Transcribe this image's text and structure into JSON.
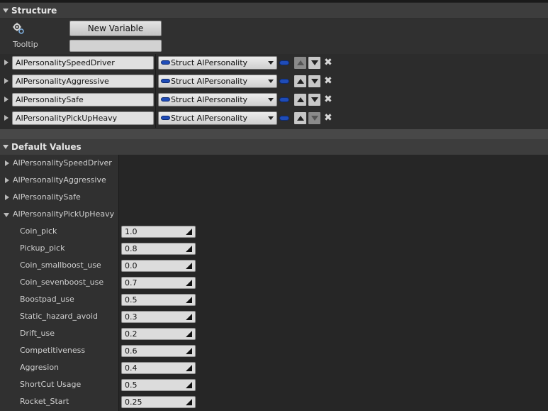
{
  "structure": {
    "title": "Structure",
    "new_variable_label": "New Variable",
    "tooltip_label": "Tooltip",
    "tooltip_value": "",
    "variables": [
      {
        "name": "AIPersonalitySpeedDriver",
        "type": "Struct AIPersonality",
        "up_enabled": false,
        "down_enabled": true
      },
      {
        "name": "AIPersonalityAggressive",
        "type": "Struct AIPersonality",
        "up_enabled": true,
        "down_enabled": true
      },
      {
        "name": "AIPersonalitySafe",
        "type": "Struct AIPersonality",
        "up_enabled": true,
        "down_enabled": true
      },
      {
        "name": "AIPersonalityPickUpHeavy",
        "type": "Struct AIPersonality",
        "up_enabled": true,
        "down_enabled": false
      }
    ]
  },
  "defaults": {
    "title": "Default Values",
    "categories": [
      {
        "name": "AIPersonalitySpeedDriver",
        "expanded": false
      },
      {
        "name": "AIPersonalityAggressive",
        "expanded": false
      },
      {
        "name": "AIPersonalitySafe",
        "expanded": false
      },
      {
        "name": "AIPersonalityPickUpHeavy",
        "expanded": true
      }
    ],
    "properties": [
      {
        "name": "Coin_pick",
        "value": "1.0"
      },
      {
        "name": "Pickup_pick",
        "value": "0.8"
      },
      {
        "name": "Coin_smallboost_use",
        "value": "0.0"
      },
      {
        "name": "Coin_sevenboost_use",
        "value": "0.7"
      },
      {
        "name": "Boostpad_use",
        "value": "0.5"
      },
      {
        "name": "Static_hazard_avoid",
        "value": "0.3"
      },
      {
        "name": "Drift_use",
        "value": "0.2"
      },
      {
        "name": "Competitiveness",
        "value": "0.6"
      },
      {
        "name": "Aggresion",
        "value": "0.4"
      },
      {
        "name": "ShortCut Usage",
        "value": "0.5"
      },
      {
        "name": "Rocket_Start",
        "value": "0.25"
      }
    ]
  },
  "colors": {
    "pin_blue": "#1f4cb8",
    "panel": "#303030",
    "header": "#3d3d3d"
  },
  "icons": {
    "add_variable": "gear-icon",
    "delete": "close-icon",
    "move_up": "arrow-up-icon",
    "move_down": "arrow-down-icon"
  }
}
